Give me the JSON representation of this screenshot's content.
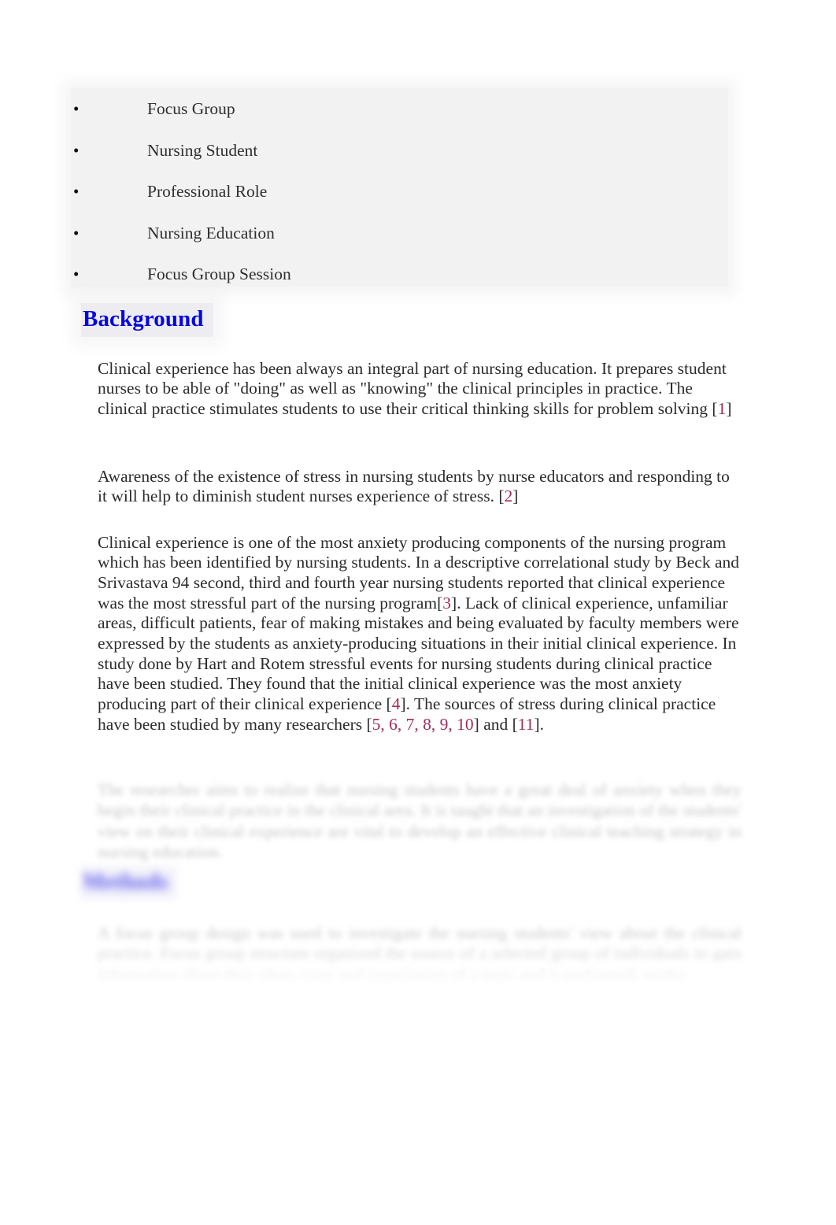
{
  "document": {
    "keywords": {
      "items": [
        {
          "label": "Focus Group"
        },
        {
          "label": "Nursing Student"
        },
        {
          "label": "Professional Role"
        },
        {
          "label": "Nursing Education"
        },
        {
          "label": "Focus Group Session"
        }
      ]
    },
    "sections": [
      {
        "heading": "Background",
        "heading_color": "#0505e2",
        "paragraphs": {
          "p1_a": "Clinical experience has been always an integral part of nursing education. It prepares student nurses to be able of \"doing\" as well as \"knowing\" the clinical principles in practice. The clinical practice stimulates students to use their critical thinking skills for problem solving ",
          "p1_cite_open": "[",
          "p1_cite_num": "1",
          "p1_cite_close": "]",
          "p2_a": "Awareness of the existence of stress in nursing students by nurse educators and responding to it will help to diminish student nurses experience of stress. ",
          "p2_cite_open": "[",
          "p2_cite_num": "2",
          "p2_cite_close": "]",
          "p3_a": "Clinical experience is one of the most anxiety producing components of the nursing program which has been identified by nursing students. In a descriptive correlational study by Beck and Srivastava 94 second, third and fourth year nursing students reported that clinical experience was the most stressful part of the nursing program",
          "p3_cite1_open": "[",
          "p3_cite1_num": "3",
          "p3_cite1_close": "]",
          "p3_b": ". Lack of clinical experience, unfamiliar areas, difficult patients, fear of making mistakes and being evaluated by faculty members were expressed by the students as anxiety-producing situations in their initial clinical experience. In study done by Hart and Rotem stressful events for nursing students during clinical practice have been studied. They found that the initial clinical experience was the most anxiety producing part of their clinical experience ",
          "p3_cite2_open": "[",
          "p3_cite2_num": "4",
          "p3_cite2_close": "]",
          "p3_c": ". The sources of stress during clinical practice have been studied by many researchers ",
          "p3_cite3_open": "[",
          "p3_cite3_nums": "5, 6, 7, 8, 9, 10",
          "p3_cite3_close": "]",
          "p3_d": " and ",
          "p3_cite4_open": "[",
          "p3_cite4_num": "11",
          "p3_cite4_close": "]",
          "p3_e": ".",
          "p4_blurred": "The researcher aims to realize that nursing students have a great deal of anxiety when they begin their clinical practice in the clinical area. It is taught that an investigation of the students' view on their clinical experience are vital to develop an effective clinical teaching strategy in nursing education."
        }
      },
      {
        "heading": "Methods",
        "heading_color": "#3b34e6",
        "paragraphs": {
          "p5_blurred": "A focus group design was used to investigate the nursing students' view about the clinical practice. Focus group structure organized the source of a selected group of individuals to gain information about their ideas, view and experiences of a topic and is performed, works"
        }
      }
    ]
  }
}
